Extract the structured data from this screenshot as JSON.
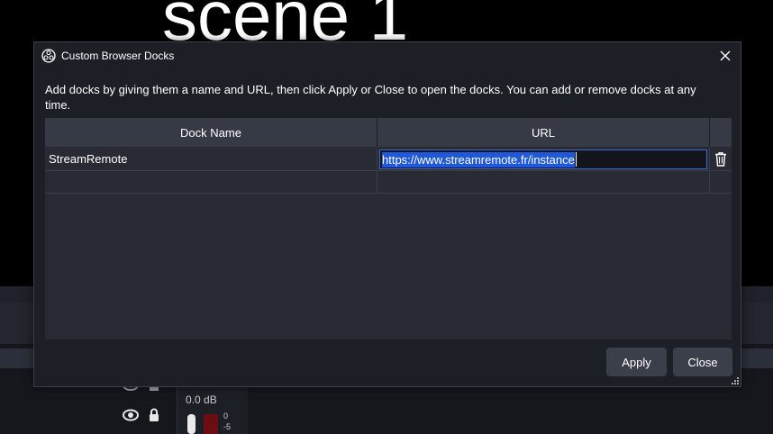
{
  "background": {
    "scene_text": "scene 1",
    "volume_db": "0.0 dB",
    "meter_labels": [
      "0",
      "-5"
    ]
  },
  "dialog": {
    "title": "Custom Browser Docks",
    "description": "Add docks by giving them a name and URL, then click Apply or Close to open the docks. You can add or remove docks at any time.",
    "columns": {
      "name": "Dock Name",
      "url": "URL"
    },
    "rows": [
      {
        "name": "StreamRemote",
        "url": "https://www.streamremote.fr/instance"
      },
      {
        "name": "",
        "url": ""
      }
    ],
    "buttons": {
      "apply": "Apply",
      "close": "Close"
    }
  },
  "colors": {
    "dialog_bg": "#1d1f26",
    "header_bg": "#363a45",
    "selection": "#1f59d9",
    "focus_border": "#3d6bd6",
    "button_bg": "#3b3f4a"
  },
  "icons": [
    "obs-logo-icon",
    "close-icon",
    "trash-icon",
    "eye-icon",
    "lock-icon",
    "resize-grip-icon"
  ]
}
